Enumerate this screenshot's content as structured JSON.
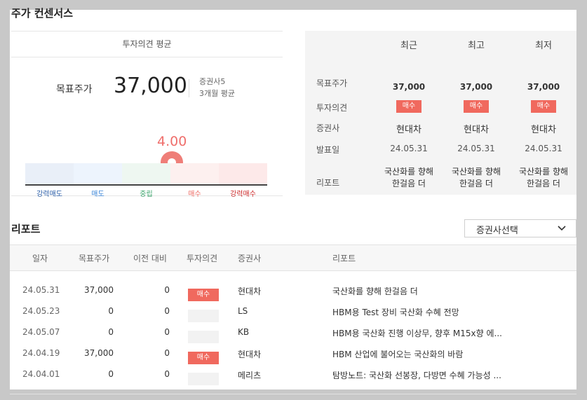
{
  "section_title": "주가 컨센서스",
  "opinion_avg": {
    "header": "투자의견 평균",
    "target_label": "목표주가",
    "target_value": "37,000",
    "brokers": "증권사5",
    "period": "3개월 평균",
    "score": "4.00",
    "scale": [
      "강력매도",
      "매도",
      "중립",
      "매수",
      "강력매수"
    ],
    "scale_colors": [
      "#2a5ea8",
      "#3b86d8",
      "#39a46a",
      "#ee6d66",
      "#cc2b2b"
    ],
    "segment_fills": [
      "#e9eff8",
      "#edf4fd",
      "#eef7f1",
      "#fdf0ef",
      "#fde9e9"
    ],
    "marker_color": "#ef7e78"
  },
  "recent_table": {
    "columns": [
      "최근",
      "최고",
      "최저"
    ],
    "row_labels": [
      "목표주가",
      "투자의견",
      "증권사",
      "발표일",
      "리포트"
    ],
    "cols": [
      {
        "target": "37,000",
        "opinion": "매수",
        "broker": "현대차",
        "date": "24.05.31",
        "report_l1": "국산화를 향해",
        "report_l2": "한걸음 더"
      },
      {
        "target": "37,000",
        "opinion": "매수",
        "broker": "현대차",
        "date": "24.05.31",
        "report_l1": "국산화를 향해",
        "report_l2": "한걸음 더"
      },
      {
        "target": "37,000",
        "opinion": "매수",
        "broker": "현대차",
        "date": "24.05.31",
        "report_l1": "국산화를 향해",
        "report_l2": "한걸음 더"
      }
    ]
  },
  "reports": {
    "title": "리포트",
    "select_label": "증권사선택",
    "headers": [
      "일자",
      "목표주가",
      "이전 대비",
      "투자의견",
      "증권사",
      "리포트"
    ],
    "rows": [
      {
        "date": "24.05.31",
        "target": "37,000",
        "change": "0",
        "opinion": "매수",
        "broker": "현대차",
        "report": "국산화를 향해 한걸음 더"
      },
      {
        "date": "24.05.23",
        "target": "0",
        "change": "0",
        "opinion": "",
        "broker": "LS",
        "report": "HBM용 Test 장비 국산화 수혜 전망"
      },
      {
        "date": "24.05.07",
        "target": "0",
        "change": "0",
        "opinion": "",
        "broker": "KB",
        "report": "HBM용 국산화 진행 이상무, 향후 M15x향 에..."
      },
      {
        "date": "24.04.19",
        "target": "37,000",
        "change": "0",
        "opinion": "매수",
        "broker": "현대차",
        "report": "HBM 산업에 불어오는 국산화의 바람"
      },
      {
        "date": "24.04.01",
        "target": "0",
        "change": "0",
        "opinion": "",
        "broker": "메리츠",
        "report": "탐방노트: 국산화 선봉장, 다방면 수혜 가능성 ..."
      }
    ]
  },
  "colors": {
    "badge": "#f0695e",
    "accent": "#ef6f6c"
  }
}
